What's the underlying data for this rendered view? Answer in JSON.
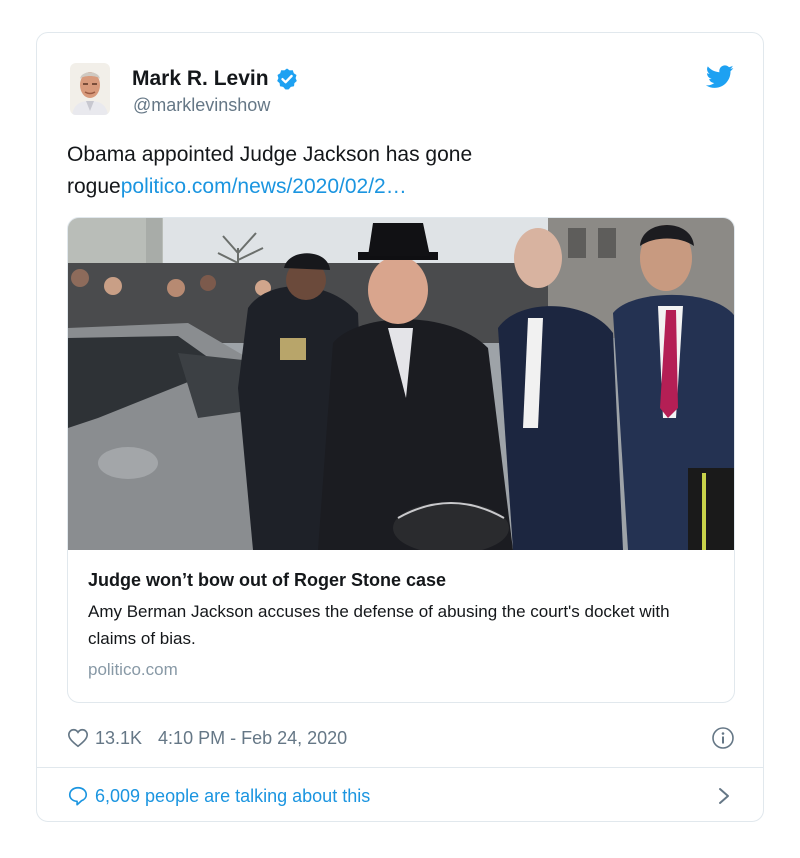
{
  "tweet": {
    "author_name": "Mark R. Levin",
    "handle": "@marklevinshow",
    "text_plain": "Obama appointed Judge Jackson has gone rogue",
    "text_link": "politico.com/news/2020/02/2…",
    "likes": "13.1K",
    "timestamp": "4:10 PM - Feb 24, 2020",
    "talking": "6,009 people are talking about this"
  },
  "link_card": {
    "title": "Judge won’t bow out of Roger Stone case",
    "description": "Amy Berman Jackson accuses the defense of abusing the court's docket with claims of bias.",
    "domain": "politico.com"
  },
  "icons": {
    "verified": "verified-badge-icon",
    "twitter": "twitter-bird-icon",
    "like": "heart-icon",
    "info": "info-icon",
    "reply": "speech-bubble-icon",
    "chevron": "chevron-right-icon"
  },
  "colors": {
    "accent": "#1da1f2",
    "link": "#1b95e0",
    "muted": "#657786",
    "border": "#e1e8ed"
  }
}
